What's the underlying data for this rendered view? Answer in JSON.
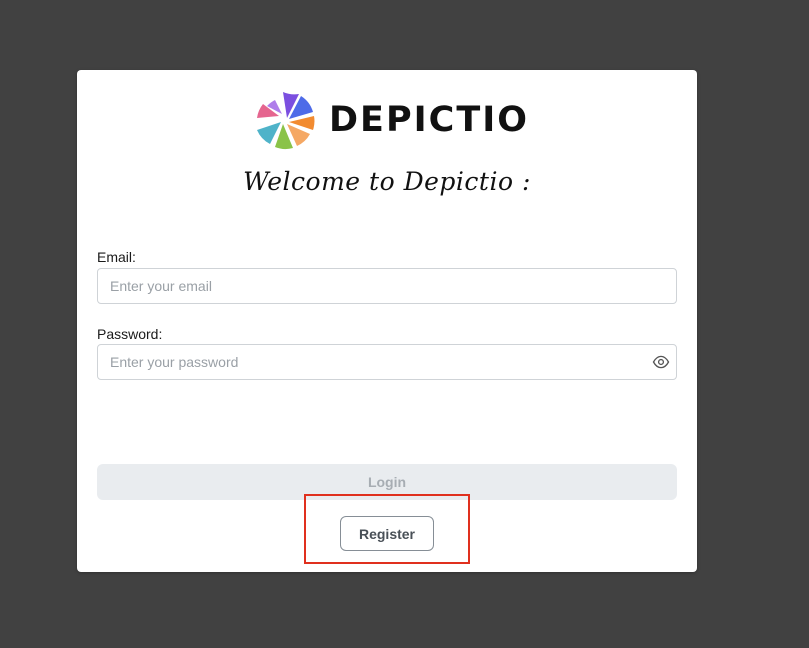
{
  "brand": {
    "name": "DEPICTIO",
    "logo_icon": "depictio-pinwheel-logo"
  },
  "welcome_text": "Welcome to Depictio :",
  "form": {
    "email": {
      "label": "Email:",
      "placeholder": "Enter your email",
      "value": ""
    },
    "password": {
      "label": "Password:",
      "placeholder": "Enter your password",
      "value": "",
      "toggle_icon": "eye-icon"
    },
    "login_label": "Login",
    "login_disabled": true,
    "register_label": "Register"
  },
  "colors": {
    "background": "#414141",
    "card": "#ffffff",
    "highlight": "#e0301e",
    "login_bg": "#e9ecef",
    "login_text": "#a7adb3",
    "logo_purple": "#7b4fe0",
    "logo_blue": "#4e6be8",
    "logo_orange": "#f28b30",
    "logo_green": "#8ac348",
    "logo_teal": "#4fb3c9",
    "logo_pink": "#e04a7b"
  }
}
